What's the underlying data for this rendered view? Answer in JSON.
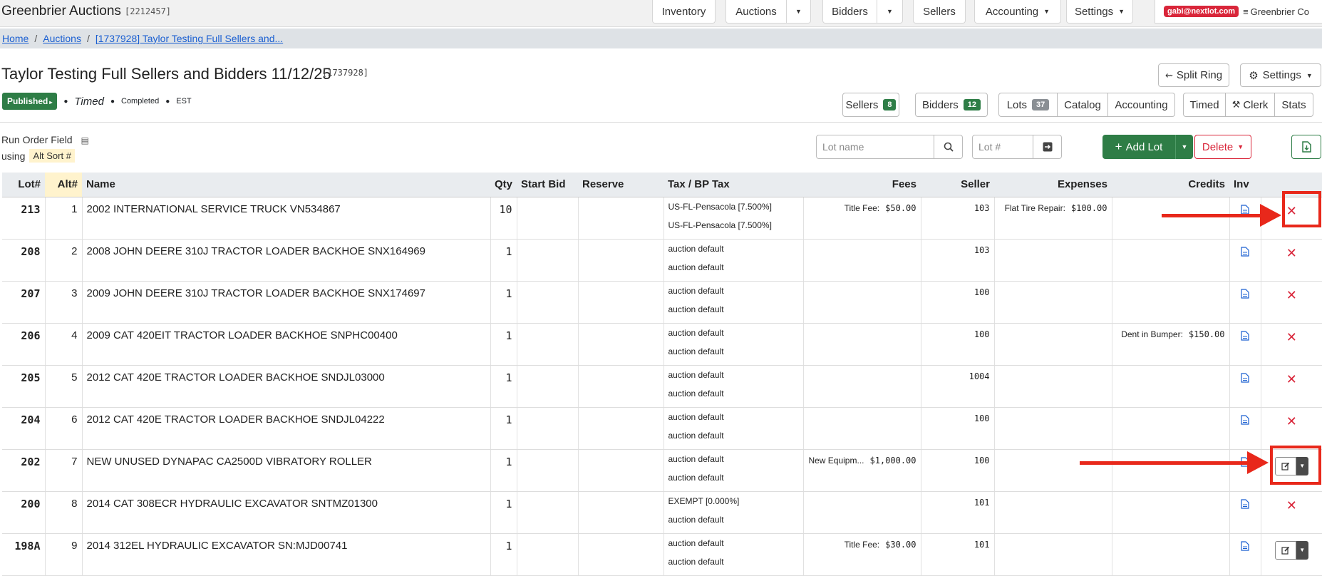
{
  "navbar": {
    "brand": "Greenbrier Auctions",
    "brand_id": "[2212457]",
    "items": {
      "inventory": "Inventory",
      "auctions": "Auctions",
      "bidders": "Bidders",
      "sellers": "Sellers",
      "accounting": "Accounting",
      "settings": "Settings"
    },
    "user_email": "gabi@nextlot.com",
    "company": "Greenbrier Co"
  },
  "breadcrumb": {
    "home": "Home",
    "auctions": "Auctions",
    "current": "[1737928] Taylor Testing Full Sellers and..."
  },
  "header": {
    "title": "Taylor Testing Full Sellers and Bidders 11/12/25",
    "auction_id": "[1737928]",
    "status_published": "Published",
    "status_type": "Timed",
    "status_completed": "Completed",
    "timezone": "EST",
    "split_ring": "Split Ring",
    "settings": "Settings",
    "sellers_label": "Sellers",
    "sellers_count": "8",
    "bidders_label": "Bidders",
    "bidders_count": "12",
    "lots_label": "Lots",
    "lots_count": "37",
    "catalog": "Catalog",
    "accounting": "Accounting",
    "timed": "Timed",
    "clerk": "Clerk",
    "stats": "Stats"
  },
  "toolbar": {
    "run_order_label": "Run Order Field",
    "using_label": "using",
    "sort_field": "Alt Sort #",
    "lot_name_placeholder": "Lot name",
    "lot_num_placeholder": "Lot #",
    "add_lot": "Add Lot",
    "delete": "Delete"
  },
  "table": {
    "headers": {
      "lot": "Lot#",
      "alt": "Alt#",
      "name": "Name",
      "qty": "Qty",
      "start_bid": "Start Bid",
      "reserve": "Reserve",
      "tax": "Tax / BP Tax",
      "fees": "Fees",
      "seller": "Seller",
      "expenses": "Expenses",
      "credits": "Credits",
      "inv": "Inv"
    },
    "rows": [
      {
        "lot": "213",
        "alt": "1",
        "name": "2002 INTERNATIONAL SERVICE TRUCK VN534867",
        "qty": "10",
        "tax1": "US-FL-Pensacola [7.500%]",
        "tax2": "US-FL-Pensacola [7.500%]",
        "fee_label": "Title Fee:",
        "fee_value": "$50.00",
        "seller": "103",
        "exp_label": "Flat Tire Repair:",
        "exp_value": "$100.00",
        "cred_label": "",
        "cred_value": "",
        "action": "delete"
      },
      {
        "lot": "208",
        "alt": "2",
        "name": "2008 JOHN DEERE 310J TRACTOR LOADER BACKHOE SNX164969",
        "qty": "1",
        "tax1": "auction default",
        "tax2": "auction default",
        "fee_label": "",
        "fee_value": "",
        "seller": "103",
        "exp_label": "",
        "exp_value": "",
        "cred_label": "",
        "cred_value": "",
        "action": "delete"
      },
      {
        "lot": "207",
        "alt": "3",
        "name": "2009 JOHN DEERE 310J TRACTOR LOADER BACKHOE SNX174697",
        "qty": "1",
        "tax1": "auction default",
        "tax2": "auction default",
        "fee_label": "",
        "fee_value": "",
        "seller": "100",
        "exp_label": "",
        "exp_value": "",
        "cred_label": "",
        "cred_value": "",
        "action": "delete"
      },
      {
        "lot": "206",
        "alt": "4",
        "name": "2009 CAT 420EIT TRACTOR LOADER BACKHOE SNPHC00400",
        "qty": "1",
        "tax1": "auction default",
        "tax2": "auction default",
        "fee_label": "",
        "fee_value": "",
        "seller": "100",
        "exp_label": "",
        "exp_value": "",
        "cred_label": "Dent in Bumper:",
        "cred_value": "$150.00",
        "action": "delete"
      },
      {
        "lot": "205",
        "alt": "5",
        "name": "2012 CAT 420E TRACTOR LOADER BACKHOE SNDJL03000",
        "qty": "1",
        "tax1": "auction default",
        "tax2": "auction default",
        "fee_label": "",
        "fee_value": "",
        "seller": "1004",
        "exp_label": "",
        "exp_value": "",
        "cred_label": "",
        "cred_value": "",
        "action": "delete"
      },
      {
        "lot": "204",
        "alt": "6",
        "name": "2012 CAT 420E TRACTOR LOADER BACKHOE SNDJL04222",
        "qty": "1",
        "tax1": "auction default",
        "tax2": "auction default",
        "fee_label": "",
        "fee_value": "",
        "seller": "100",
        "exp_label": "",
        "exp_value": "",
        "cred_label": "",
        "cred_value": "",
        "action": "delete"
      },
      {
        "lot": "202",
        "alt": "7",
        "name": "NEW UNUSED DYNAPAC CA2500D VIBRATORY ROLLER",
        "qty": "1",
        "tax1": "auction default",
        "tax2": "auction default",
        "fee_label": "New Equipm...",
        "fee_value": "$1,000.00",
        "seller": "100",
        "exp_label": "",
        "exp_value": "",
        "cred_label": "",
        "cred_value": "",
        "action": "edit"
      },
      {
        "lot": "200",
        "alt": "8",
        "name": "2014 CAT 308ECR HYDRAULIC EXCAVATOR SNTMZ01300",
        "qty": "1",
        "tax1": "EXEMPT [0.000%]",
        "tax2": "auction default",
        "fee_label": "",
        "fee_value": "",
        "seller": "101",
        "exp_label": "",
        "exp_value": "",
        "cred_label": "",
        "cred_value": "",
        "action": "delete"
      },
      {
        "lot": "198A",
        "alt": "9",
        "name": "2014 312EL HYDRAULIC EXCAVATOR SN:MJD00741",
        "qty": "1",
        "tax1": "auction default",
        "tax2": "auction default",
        "fee_label": "Title Fee:",
        "fee_value": "$30.00",
        "seller": "101",
        "exp_label": "",
        "exp_value": "",
        "cred_label": "",
        "cred_value": "",
        "action": "edit"
      }
    ]
  },
  "colors": {
    "accent_green": "#2e7d46",
    "danger_red": "#d9263a",
    "annotation_red": "#e8281b",
    "link_blue": "#1a5fd1",
    "highlight_yellow": "#fff3cd"
  }
}
